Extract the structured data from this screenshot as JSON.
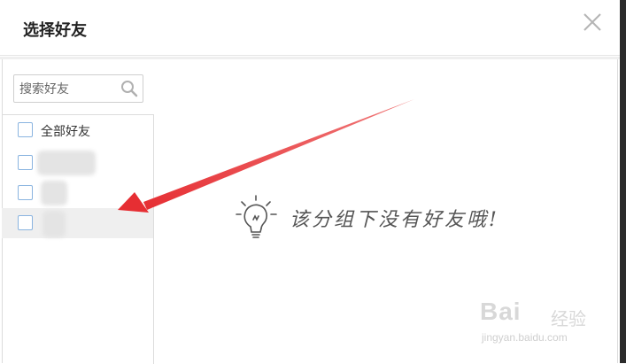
{
  "dialog": {
    "title": "选择好友",
    "close_icon": "close-icon"
  },
  "search": {
    "placeholder": "搜索好友",
    "value": "",
    "icon": "search-icon"
  },
  "friend_list": {
    "items": [
      {
        "label": "全部好友",
        "checked": false
      },
      {
        "label": "",
        "checked": false
      },
      {
        "label": "",
        "checked": false
      },
      {
        "label": "",
        "checked": false
      }
    ]
  },
  "empty_state": {
    "icon": "lightbulb-icon",
    "message": "该分组下没有好友哦!"
  },
  "watermark": {
    "brand": "Bai",
    "brand_cn": "经验",
    "url": "jingyan.baidu.com"
  },
  "annotation": {
    "arrow_color": "#e8363a"
  },
  "colors": {
    "checkbox_border": "#8ab4e0",
    "selected_row": "#efefef"
  }
}
